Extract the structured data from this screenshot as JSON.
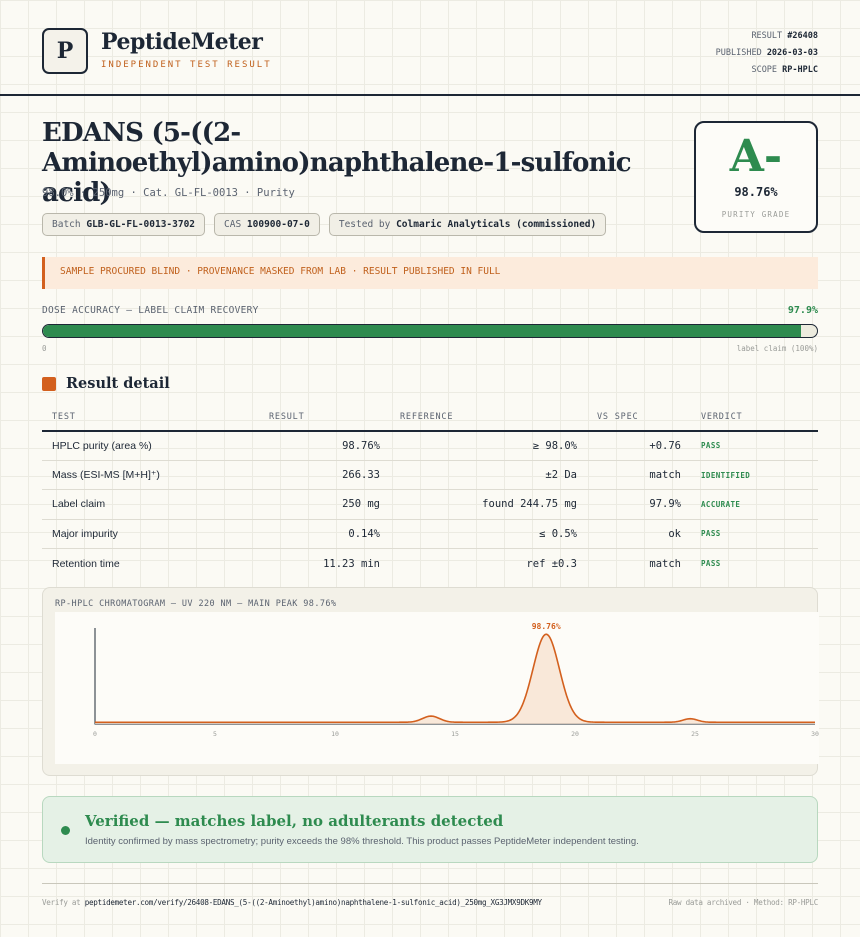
{
  "brand": {
    "logo_letter": "P",
    "name": "PeptideMeter",
    "tagline": "INDEPENDENT TEST RESULT"
  },
  "meta": {
    "result_label": "RESULT",
    "result_value": "#26408",
    "published_label": "PUBLISHED",
    "published_value": "2026-03-03",
    "scope_label": "SCOPE",
    "scope_value": "RP-HPLC"
  },
  "product": {
    "title": "EDANS (5-((2-Aminoethyl)amino)naphthalene-1-sulfonic acid)",
    "subline": "98.0% · 250mg · Cat. GL-FL-0013 · Purity",
    "chips": [
      {
        "label": "Batch",
        "value": "GLB-GL-FL-0013-3702"
      },
      {
        "label": "CAS",
        "value": "100900-07-0"
      },
      {
        "label": "Tested by",
        "value": "Colmaric Analyticals (commissioned)"
      }
    ]
  },
  "grade": {
    "letter": "A-",
    "value": "98.76%",
    "label": "PURITY GRADE"
  },
  "notice": "SAMPLE PROCURED BLIND · PROVENANCE MASKED FROM LAB · RESULT PUBLISHED IN FULL",
  "dose": {
    "label": "DOSE ACCURACY — LABEL CLAIM RECOVERY",
    "percent_text": "97.9%",
    "fill_percent": 97.9,
    "min_label": "0",
    "max_label": "label claim (100%)"
  },
  "section_title": "Result detail",
  "table": {
    "headers": [
      "TEST",
      "RESULT",
      "REFERENCE",
      "VS SPEC",
      "VERDICT"
    ],
    "rows": [
      {
        "test": "HPLC purity (area %)",
        "result": "98.76%",
        "reference": "≥ 98.0%",
        "vs_spec": "+0.76",
        "verdict": "PASS"
      },
      {
        "test": "Mass (ESI-MS [M+H]⁺)",
        "result": "266.33",
        "reference": "±2 Da",
        "vs_spec": "match",
        "verdict": "IDENTIFIED"
      },
      {
        "test": "Label claim",
        "result": "250 mg",
        "reference": "found 244.75 mg",
        "vs_spec": "97.9%",
        "verdict": "ACCURATE"
      },
      {
        "test": "Major impurity",
        "result": "0.14%",
        "reference": "≤ 0.5%",
        "vs_spec": "ok",
        "verdict": "PASS"
      },
      {
        "test": "Retention time",
        "result": "11.23 min",
        "reference": "ref ±0.3",
        "vs_spec": "match",
        "verdict": "PASS"
      }
    ]
  },
  "chart_data": {
    "type": "line",
    "title": "RP-HPLC CHROMATOGRAM — UV 220 NM — MAIN PEAK 98.76%",
    "x_ticks": [
      "0",
      "5",
      "10",
      "15",
      "20",
      "25",
      "30"
    ],
    "xlim": [
      0,
      30
    ],
    "peak_label": "98.76%",
    "peaks": [
      {
        "x": 14,
        "height": 0.07,
        "width": 0.35
      },
      {
        "x": 18.8,
        "height": 1.0,
        "width": 0.55
      },
      {
        "x": 24.8,
        "height": 0.04,
        "width": 0.3
      }
    ],
    "baseline": 0.02,
    "line_color": "#d3601e",
    "fill_color": "#f6dfcc"
  },
  "verified": {
    "title": "Verified — matches label, no adulterants detected",
    "text": "Identity confirmed by mass spectrometry; purity exceeds the 98% threshold. This product passes PeptideMeter independent testing."
  },
  "footer": {
    "verify_prefix": "Verify at",
    "verify_url": "peptidemeter.com/verify/26408-EDANS_(5-((2-Aminoethyl)amino)naphthalene-1-sulfonic_acid)_250mg_XG3JMX9DK9MY",
    "right": "Raw data archived · Method: RP-HPLC"
  },
  "colors": {
    "accent": "#d3601e",
    "pass": "#2e8b4f",
    "ink": "#1d2735"
  }
}
